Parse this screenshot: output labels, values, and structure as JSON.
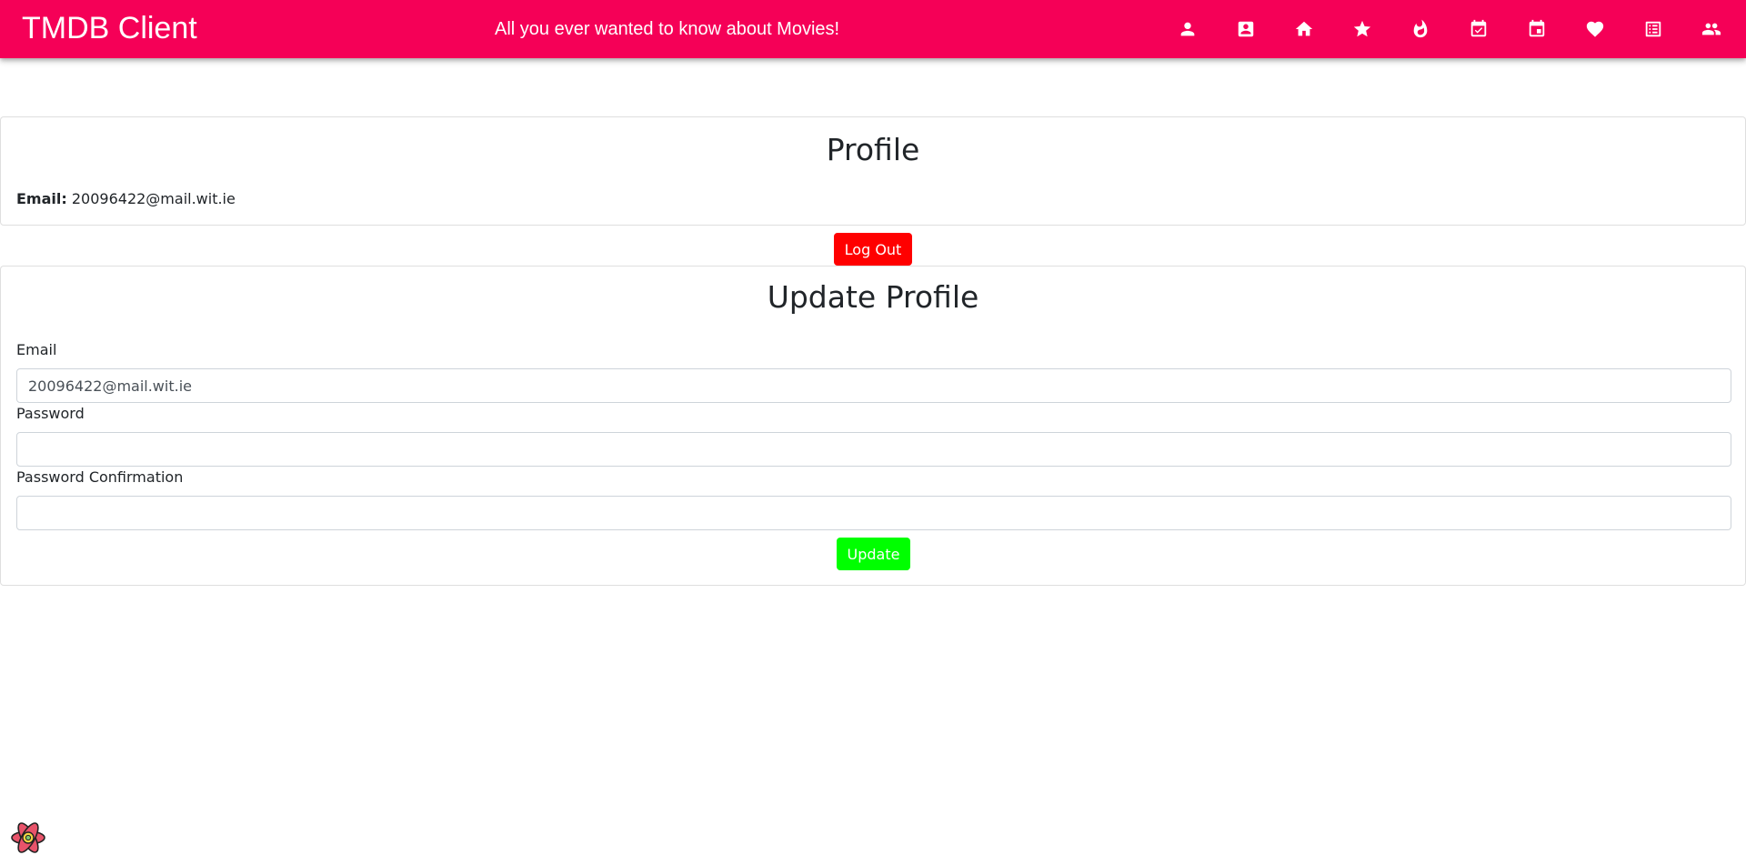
{
  "app": {
    "title": "TMDB Client",
    "tagline": "All you ever wanted to know about Movies!",
    "accent_color": "#f50057"
  },
  "nav": {
    "icons": [
      {
        "name": "person-icon"
      },
      {
        "name": "account-box-icon"
      },
      {
        "name": "home-icon"
      },
      {
        "name": "star-icon"
      },
      {
        "name": "whatshot-icon"
      },
      {
        "name": "event-available-icon"
      },
      {
        "name": "event-icon"
      },
      {
        "name": "favorite-icon"
      },
      {
        "name": "list-alt-icon"
      },
      {
        "name": "people-icon"
      }
    ]
  },
  "profile": {
    "title": "Profile",
    "email_label": "Email:",
    "email_value": "20096422@mail.wit.ie"
  },
  "logout": {
    "label": "Log Out",
    "color": "#ff0000"
  },
  "update_profile": {
    "title": "Update Profile",
    "email_label": "Email",
    "email_value": "20096422@mail.wit.ie",
    "password_label": "Password",
    "password_value": "",
    "password_confirm_label": "Password Confirmation",
    "password_confirm_value": "",
    "submit_label": "Update",
    "submit_color": "#00ff00"
  },
  "devtools": {
    "icon": "react-devtools-icon"
  }
}
